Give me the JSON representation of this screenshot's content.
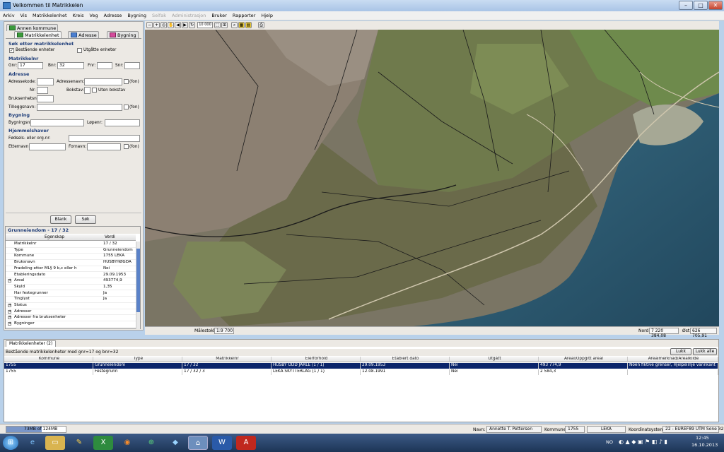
{
  "window": {
    "title": "Velkommen til Matrikkelen"
  },
  "menu": [
    "Arkiv",
    "Vis",
    "Matrikkelenhet",
    "Kreis",
    "Veg",
    "Adresse",
    "Bygning",
    "Selfak",
    "Administrasjon",
    "Bruker",
    "Rapporter",
    "Hjelp"
  ],
  "menu_disabled": [
    false,
    false,
    false,
    false,
    false,
    false,
    false,
    true,
    true,
    false,
    false,
    false
  ],
  "left": {
    "tab_top": "Annen kommune",
    "tabs": [
      "Matrikkelenhet",
      "Adresse",
      "Bygning"
    ],
    "header": "Søk etter matrikkelenhet",
    "cb_existing": "Bestående enheter",
    "cb_expired": "Utgåtte enheter",
    "sec_matr": "Matrikkelnr",
    "gnr_l": "Gnr:",
    "gnr_v": "17",
    "bnr_l": "Bnr:",
    "bnr_v": "32",
    "fnr_l": "Fnr:",
    "snr_l": "Snr:",
    "sec_addr": "Adresse",
    "addr_code": "Adressekode:",
    "addr_name": "Adressenavn:",
    "fon": "(fon)",
    "nr": "Nr:",
    "bokstav": "Bokstav:",
    "uten": "Uten bokstav",
    "bruksenhet": "Bruksenhetsnr:",
    "tillegg": "Tilleggsnavn:",
    "sec_bygg": "Bygning",
    "byggnr": "Bygningsnr:",
    "lopenr": "Løpenr:",
    "sec_hjem": "Hjemmelshaver",
    "fodsel": "Fødsels- eller org.nr:",
    "etternavn": "Etternavn:",
    "fornavn": "Fornavn:",
    "blank": "Blank",
    "sok": "Søk"
  },
  "props": {
    "title": "Grunneiendom - 17 / 32",
    "col1": "Egenskap",
    "col2": "Verdi",
    "rows": [
      {
        "k": "Matrikkelnr",
        "v": "17 / 32",
        "exp": false
      },
      {
        "k": "Type",
        "v": "Grunneiendom",
        "exp": false
      },
      {
        "k": "Kommune",
        "v": "1755 LEKA",
        "exp": false
      },
      {
        "k": "Bruksnavn",
        "v": "HUSBYHØGDA",
        "exp": false
      },
      {
        "k": "Fradeling etter ML§ 9 b,c eller h",
        "v": "Nei",
        "exp": false
      },
      {
        "k": "Etableringsdato",
        "v": "29.09.1953",
        "exp": false
      },
      {
        "k": "Areal",
        "v": "493774,9",
        "exp": true
      },
      {
        "k": "Skyld",
        "v": "1,35",
        "exp": false
      },
      {
        "k": "Har festegrunner",
        "v": "Ja",
        "exp": false
      },
      {
        "k": "Tinglyst",
        "v": "Ja",
        "exp": false
      },
      {
        "k": "Status",
        "v": "",
        "exp": true
      },
      {
        "k": "Adresser",
        "v": "",
        "exp": true
      },
      {
        "k": "Adresser fra bruksenheter",
        "v": "",
        "exp": true
      },
      {
        "k": "Bygninger",
        "v": "",
        "exp": true
      }
    ]
  },
  "map": {
    "scale_label": "Målestokk:",
    "scale_value": "1:9 700",
    "scale_combo": "10 000",
    "north_label": "Nord:",
    "north_value": "7 220 384,08",
    "east_label": "Øst:",
    "east_value": "626 705,91"
  },
  "results": {
    "tab": "Matrikkelenheter (2)",
    "header": "Bestående matrikkelenheter med gnr=17 og bnr=32",
    "lukk": "Lukk",
    "lukk_alle": "Lukk alle",
    "columns": [
      "Kommune",
      "Type",
      "Matrikkelnr",
      "Eierforhold",
      "Etablert dato",
      "Utgått",
      "Areal/Oppgitt areal",
      "Arealmerknad/Arealkilde"
    ],
    "rows": [
      [
        "1755",
        "Grunneiendom",
        "17 / 32",
        "HUSBY ODD JARLE (1 / 1)",
        "29.09.1953",
        "Nei",
        "493 774,9",
        "Noen fiktive grenser, Hjelpelinje vannkant"
      ],
      [
        "1755",
        "Festegrunn",
        "17 / 32 / 3",
        "LEKA SKYTTERLAG (1 / 1)",
        "12.08.1991",
        "Nei",
        "2 584,3",
        ""
      ]
    ]
  },
  "status": {
    "memory": "73MB of 124MB",
    "memory_fraction": 0.59,
    "navn_l": "Navn:",
    "navn_v": "Annette T. Pettersen",
    "kommune_l": "Kommune:",
    "kommune_nr": "1755",
    "kommune_navn": "LEKA",
    "koord_l": "Koordinatsystem:",
    "koord_v": "22 - EUREF89 UTM Sone 32"
  },
  "taskbar": {
    "lang": "NO",
    "time": "12:45",
    "date": "16.10.2013"
  }
}
